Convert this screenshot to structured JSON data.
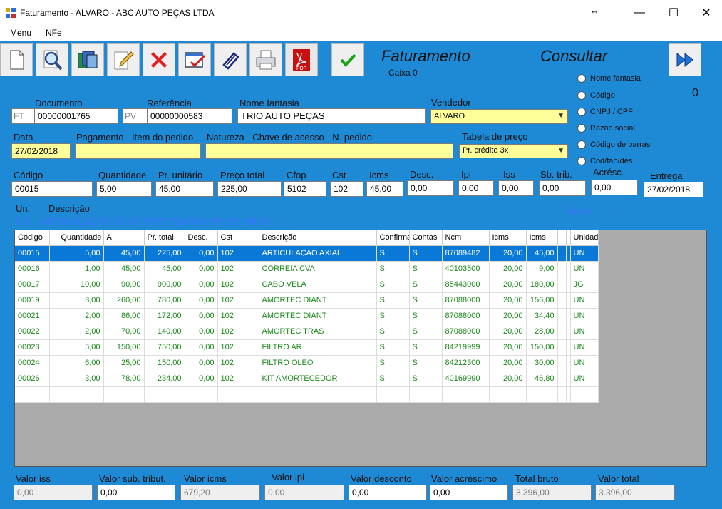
{
  "window": {
    "title": "Faturamento - ALVARO - ABC AUTO PEÇAS LTDA",
    "resize_glyph": "↔",
    "minimize": "—",
    "maximize": "☐",
    "close": "✕"
  },
  "menu": {
    "items": [
      "Menu",
      "NFe"
    ]
  },
  "toolbar": {
    "icons": [
      "new-document-icon",
      "search-magnifier-icon",
      "open-folder-icon",
      "edit-pencil-icon",
      "delete-x-icon",
      "calendar-check-icon",
      "attach-icon",
      "print-icon",
      "pdf-icon",
      "confirm-check-icon"
    ],
    "pdf_label": "PDF"
  },
  "header": {
    "module_title": "Faturamento",
    "caixa": "Caixa 0",
    "mode_title": "Consultar",
    "counter": "0",
    "next_icon": "fast-forward-icon"
  },
  "search_options": [
    "Nome fantasia",
    "Código",
    "CNPJ / CPF",
    "Razão social",
    "Código de barras",
    "Cod/fab/des"
  ],
  "form": {
    "documento": {
      "label": "Documento",
      "prefix": "FT",
      "value": "00000001765"
    },
    "referencia": {
      "label": "Referência",
      "prefix": "PV",
      "value": "00000000583"
    },
    "nome_fantasia": {
      "label": "Nome fantasia",
      "value": "TRIO AUTO PEÇAS"
    },
    "vendedor": {
      "label": "Vendedor",
      "value": "ALVARO"
    },
    "data": {
      "label": "Data",
      "value": "27/02/2018"
    },
    "pagamento": {
      "label": "Pagamento - Item do pedido",
      "value": ""
    },
    "natureza": {
      "label": "Natureza - Chave de acesso - N. pedido",
      "value": ""
    },
    "tabela_preco": {
      "label": "Tabela de preço",
      "value": "Pr. crédito 3x"
    }
  },
  "item": {
    "codigo": {
      "label": "Código",
      "value": "00015"
    },
    "quantidade": {
      "label": "Quantidade",
      "value": "5,00"
    },
    "pr_unitario": {
      "label": "Pr. unitário",
      "value": "45,00"
    },
    "preco_total": {
      "label": "Preço total",
      "value": "225,00"
    },
    "cfop": {
      "label": "Cfop",
      "value": "5102"
    },
    "cst": {
      "label": "Cst",
      "value": "102"
    },
    "icms": {
      "label": "Icms",
      "value": "45,00"
    },
    "desc": {
      "label": "Desc.",
      "value": "0,00"
    },
    "ipi": {
      "label": "Ipi",
      "value": "0,00"
    },
    "iss": {
      "label": "Iss",
      "value": "0,00"
    },
    "sb_trib": {
      "label": "Sb. trib.",
      "value": "0,00"
    },
    "acresc": {
      "label": "Acrésc.",
      "value": "0,00"
    },
    "entrega": {
      "label": "Entrega",
      "value": "27/02/2018"
    },
    "un_label": "Un.",
    "descricao_label": "Descrição",
    "un_value": "UN",
    "descricao_value": "ARTICULAÇAO AXIAL FIAT TEMPRA/PALIO DH 01...",
    "saldo_label": "Saldo",
    "saldo_value": "...."
  },
  "grid": {
    "columns": [
      "Código",
      "",
      "Quantidade",
      "A",
      "Pr. total",
      "Desc.",
      "Cst",
      "",
      "Descrição",
      "Confirma",
      "Contas",
      "Ncm",
      "Icms",
      "Icms",
      "",
      "",
      "",
      "Unidad"
    ],
    "rows": [
      [
        "00015",
        "5,00",
        "45,00",
        "225,00",
        "0,00",
        "102",
        "ARTICULAÇAO AXIAL",
        "S",
        "S",
        "87089482",
        "20,00",
        "45,00",
        "UN"
      ],
      [
        "00016",
        "1,00",
        "45,00",
        "45,00",
        "0,00",
        "102",
        "CORREIA CVA",
        "S",
        "S",
        "40103500",
        "20,00",
        "9,00",
        "UN"
      ],
      [
        "00017",
        "10,00",
        "90,00",
        "900,00",
        "0,00",
        "102",
        "CABO VELA",
        "S",
        "S",
        "85443000",
        "20,00",
        "180,00",
        "JG"
      ],
      [
        "00019",
        "3,00",
        "260,00",
        "780,00",
        "0,00",
        "102",
        "AMORTEC DIANT",
        "S",
        "S",
        "87088000",
        "20,00",
        "156,00",
        "UN"
      ],
      [
        "00021",
        "2,00",
        "86,00",
        "172,00",
        "0,00",
        "102",
        "AMORTEC DIANT",
        "S",
        "S",
        "87088000",
        "20,00",
        "34,40",
        "UN"
      ],
      [
        "00022",
        "2,00",
        "70,00",
        "140,00",
        "0,00",
        "102",
        "AMORTEC TRAS",
        "S",
        "S",
        "87088000",
        "20,00",
        "28,00",
        "UN"
      ],
      [
        "00023",
        "5,00",
        "150,00",
        "750,00",
        "0,00",
        "102",
        "FILTRO AR",
        "S",
        "S",
        "84219999",
        "20,00",
        "150,00",
        "UN"
      ],
      [
        "00024",
        "6,00",
        "25,00",
        "150,00",
        "0,00",
        "102",
        "FILTRO OLEO",
        "S",
        "S",
        "84212300",
        "20,00",
        "30,00",
        "UN"
      ],
      [
        "00026",
        "3,00",
        "78,00",
        "234,00",
        "0,00",
        "102",
        "KIT AMORTECEDOR",
        "S",
        "S",
        "40169990",
        "20,00",
        "46,80",
        "UN"
      ]
    ]
  },
  "totals": [
    {
      "label": "Valor iss",
      "value": "0,00",
      "readonly": true
    },
    {
      "label": "Valor sub. tribut.",
      "value": "0,00",
      "readonly": false
    },
    {
      "label": "Valor icms",
      "value": "679,20",
      "readonly": true
    },
    {
      "label": "Valor ipi",
      "value": "0,00",
      "readonly": true
    },
    {
      "label": "Valor desconto",
      "value": "0,00",
      "readonly": false
    },
    {
      "label": "Valor acréscimo",
      "value": "0,00",
      "readonly": false
    },
    {
      "label": "Total bruto",
      "value": "3.396,00",
      "readonly": true
    },
    {
      "label": "Valor total",
      "value": "3.396,00",
      "readonly": true
    }
  ],
  "colors": {
    "workspace": "#1e8ad6",
    "field_yellow": "#ffff99",
    "row_text": "#1b8a1b",
    "selection": "#0a78d7",
    "description_blue": "#3e74ff"
  }
}
